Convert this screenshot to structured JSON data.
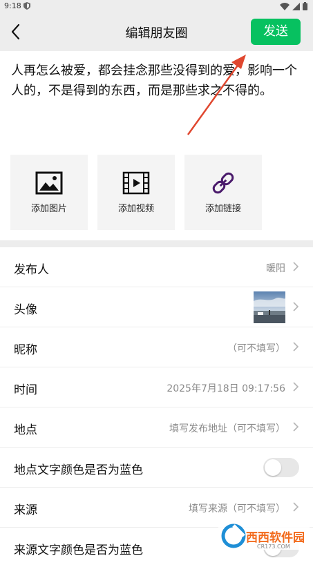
{
  "status_bar": {
    "time": "9:18"
  },
  "header": {
    "title": "编辑朋友圈",
    "send_label": "发送"
  },
  "post": {
    "text": "人再怎么被爱，都会挂念那些没得到的爱，影响一个人的，不是得到的东西，而是那些求之不得的。"
  },
  "media_buttons": [
    {
      "label": "添加图片",
      "icon": "image-icon"
    },
    {
      "label": "添加视频",
      "icon": "film-icon"
    },
    {
      "label": "添加链接",
      "icon": "link-icon"
    }
  ],
  "settings": {
    "publisher": {
      "label": "发布人",
      "value": "暖阳"
    },
    "avatar": {
      "label": "头像"
    },
    "nickname": {
      "label": "昵称",
      "value": "（可不填写）"
    },
    "time": {
      "label": "时间",
      "value": "2025年7月18日 09:17:56"
    },
    "location": {
      "label": "地点",
      "value": "填写发布地址（可不填写）"
    },
    "location_blue": {
      "label": "地点文字颜色是否为蓝色",
      "enabled": false
    },
    "source": {
      "label": "来源",
      "value": "填写来源（可不填写）"
    },
    "source_blue": {
      "label": "来源文字颜色是否为蓝色",
      "enabled": false
    }
  },
  "watermark": {
    "text": "西西软件园",
    "sub": "CR173.COM"
  },
  "colors": {
    "accent": "#07c160",
    "background": "#ededed",
    "arrow": "#e0472f"
  }
}
